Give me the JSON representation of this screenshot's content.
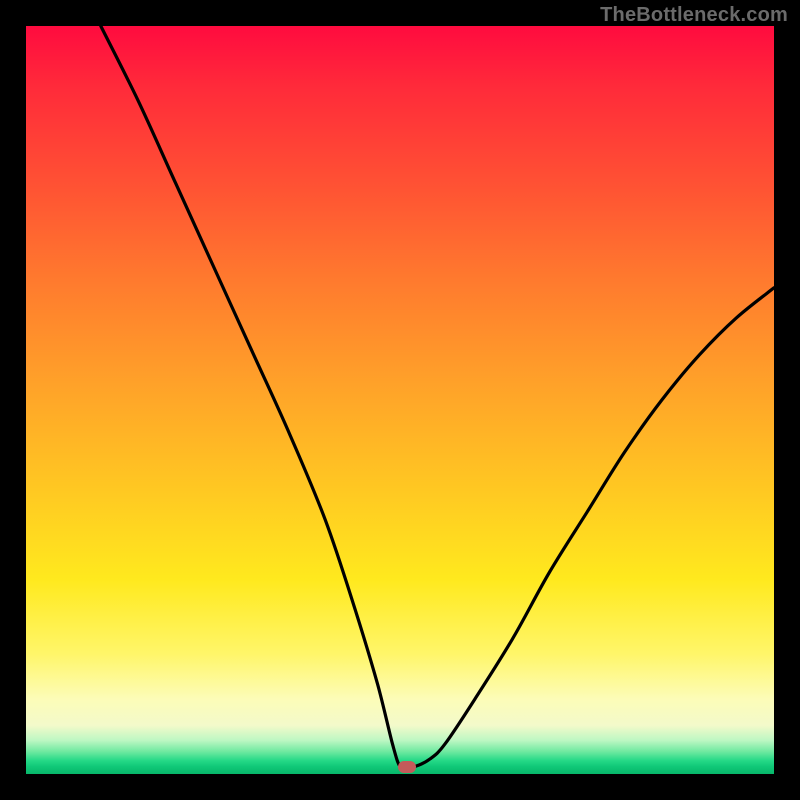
{
  "watermark": "TheBottleneck.com",
  "chart_data": {
    "type": "line",
    "title": "",
    "xlabel": "",
    "ylabel": "",
    "xlim": [
      0,
      100
    ],
    "ylim": [
      0,
      100
    ],
    "grid": false,
    "legend": false,
    "series": [
      {
        "name": "bottleneck-curve",
        "x": [
          10,
          15,
          20,
          25,
          30,
          35,
          40,
          44,
          47,
          49,
          50,
          51,
          52,
          54,
          56,
          60,
          65,
          70,
          75,
          80,
          85,
          90,
          95,
          100
        ],
        "values": [
          100,
          90,
          79,
          68,
          57,
          46,
          34,
          22,
          12,
          4,
          1,
          1,
          1,
          2,
          4,
          10,
          18,
          27,
          35,
          43,
          50,
          56,
          61,
          65
        ]
      }
    ],
    "annotations": [
      {
        "name": "optimal-marker",
        "x": 51,
        "y": 1
      }
    ],
    "gradient_stops": [
      {
        "pos": 0,
        "color": "#ff0b3f"
      },
      {
        "pos": 0.5,
        "color": "#ffc822"
      },
      {
        "pos": 0.95,
        "color": "#bdf7c3"
      },
      {
        "pos": 1.0,
        "color": "#07b66a"
      }
    ]
  }
}
